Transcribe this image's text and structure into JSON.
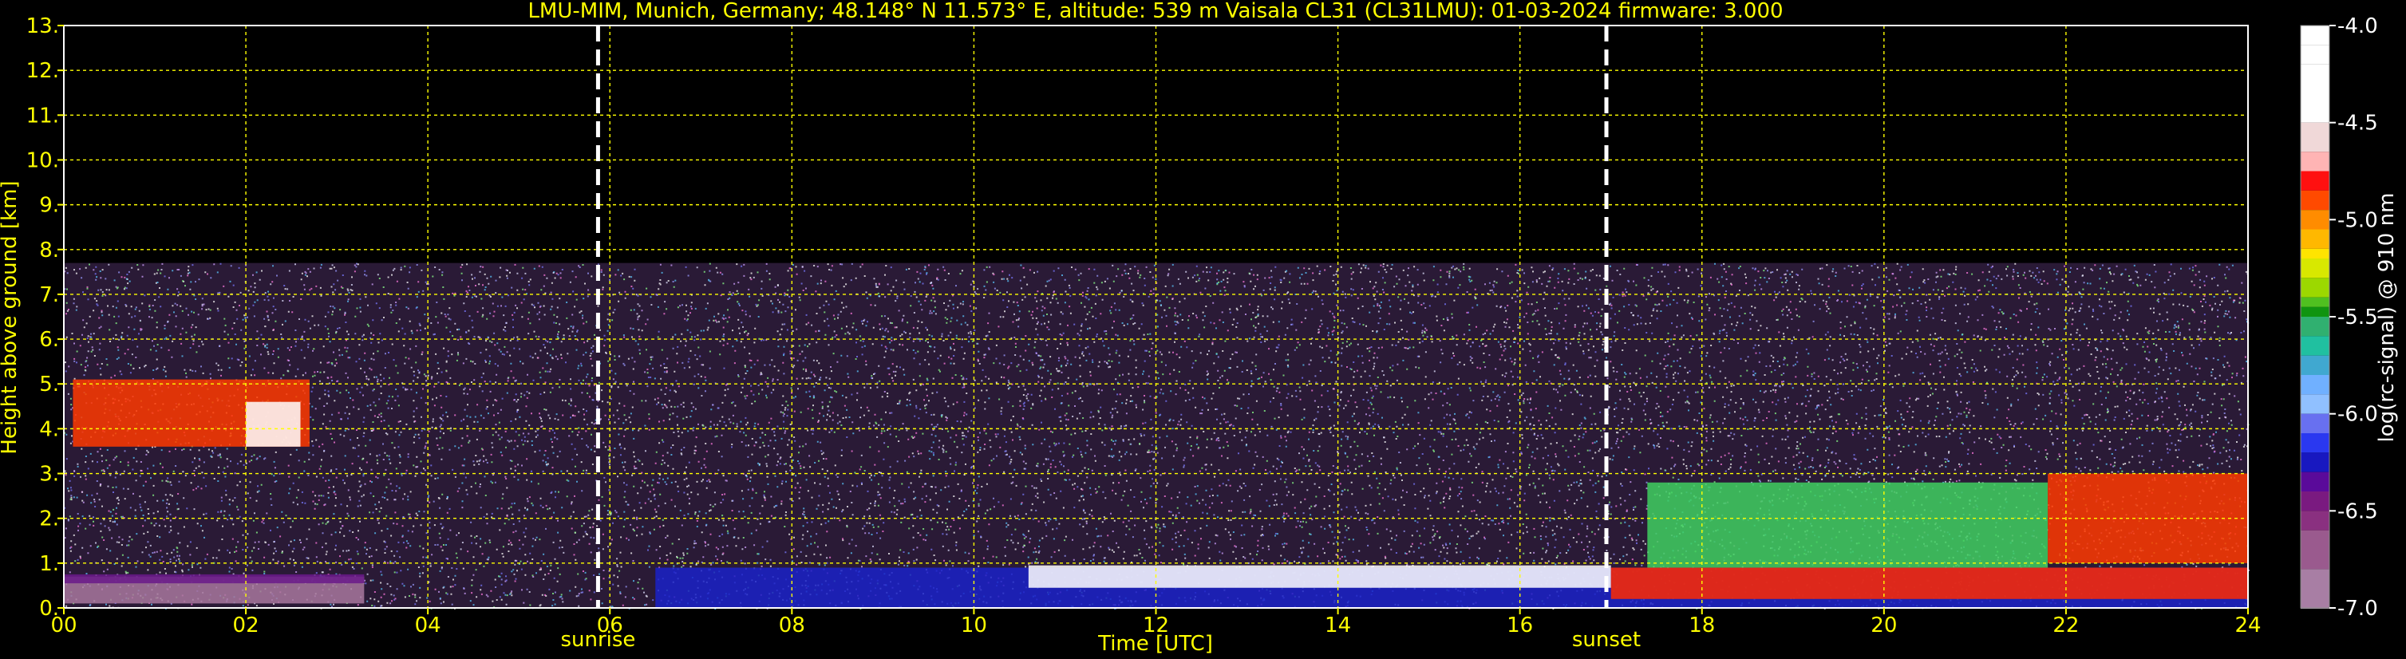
{
  "chart_data": {
    "type": "heatmap",
    "title": "LMU-MIM, Munich, Germany; 48.148° N 11.573° E, altitude: 539 m    Vaisala CL31 (CL31LMU): 01-03-2024    firmware: 3.000",
    "xlabel": "Time [UTC]",
    "ylabel": "Height above ground [km]",
    "xlim": [
      0,
      24
    ],
    "ylim": [
      0,
      13
    ],
    "x_ticks": [
      0,
      2,
      4,
      6,
      8,
      10,
      12,
      14,
      16,
      18,
      20,
      22,
      24
    ],
    "x_tick_labels": [
      "00",
      "02",
      "04",
      "06",
      "08",
      "10",
      "12",
      "14",
      "16",
      "18",
      "20",
      "22",
      "24"
    ],
    "y_ticks": [
      0,
      1,
      2,
      3,
      4,
      5,
      6,
      7,
      8,
      9,
      10,
      11,
      12,
      13
    ],
    "y_tick_labels": [
      "0.",
      "1.",
      "2.",
      "3.",
      "4.",
      "5.",
      "6.",
      "7.",
      "8.",
      "9.",
      "10.",
      "11.",
      "12.",
      "13."
    ],
    "grid": true,
    "grid_color": "#ffff00",
    "vertical_markers": [
      {
        "label": "sunrise",
        "x": 5.87
      },
      {
        "label": "sunset",
        "x": 16.95
      }
    ],
    "colorbar": {
      "label": "log(rc-signal) @ 910 nm",
      "range": [
        -7.0,
        -4.0
      ],
      "ticks": [
        -4.0,
        -4.5,
        -5.0,
        -5.5,
        -6.0,
        -6.5,
        -7.0
      ],
      "tick_labels": [
        "-4.0",
        "-4.5",
        "-5.0",
        "-5.5",
        "-6.0",
        "-6.5",
        "-7.0"
      ],
      "colors": [
        "#ffffff",
        "#ffffff",
        "#ffffff",
        "#ffffff",
        "#f0d8d8",
        "#ffb4b4",
        "#ff1010",
        "#ff4a00",
        "#ff8c00",
        "#ffb800",
        "#ffe400",
        "#d8e800",
        "#9cd800",
        "#50c020",
        "#109410",
        "#30b070",
        "#20c0a0",
        "#40a8d0",
        "#70b0ff",
        "#90c0ff",
        "#6870f0",
        "#2a38f0",
        "#1818c0",
        "#5a0a9a",
        "#7a1a80",
        "#8a3080",
        "#9a5a8e",
        "#a87ea4",
        "#b6a0b4"
      ],
      "color_values": [
        -4.0,
        -4.1,
        -4.2,
        -4.3,
        -4.5,
        -4.65,
        -4.75,
        -4.85,
        -4.95,
        -5.05,
        -5.15,
        -5.2,
        -5.3,
        -5.4,
        -5.45,
        -5.5,
        -5.6,
        -5.7,
        -5.8,
        -5.9,
        -6.0,
        -6.1,
        -6.2,
        -6.3,
        -6.4,
        -6.5,
        -6.6,
        -6.8,
        -7.0
      ]
    },
    "noise_top_km": 7.7,
    "features": [
      {
        "name": "surface layer",
        "t0": 0,
        "t1": 3.3,
        "h0": 0.1,
        "h1": 0.7,
        "color": "#a8789e"
      },
      {
        "name": "residual layer",
        "t0": 0,
        "t1": 3.3,
        "h0": 0.55,
        "h1": 0.75,
        "color": "#6a1a8a"
      },
      {
        "name": "cirrus band",
        "t0": 0.1,
        "t1": 2.7,
        "h0": 3.6,
        "h1": 5.1,
        "color": "#ff3a00"
      },
      {
        "name": "cirrus core",
        "t0": 2.0,
        "t1": 2.6,
        "h0": 3.6,
        "h1": 4.6,
        "color": "#ffffff"
      },
      {
        "name": "boundary layer",
        "t0": 6.5,
        "t1": 24,
        "h0": 0.0,
        "h1": 0.9,
        "color": "#1a22c8"
      },
      {
        "name": "cloud base",
        "t0": 10.6,
        "t1": 17.0,
        "h0": 0.45,
        "h1": 0.95,
        "color": "#ffffff"
      },
      {
        "name": "evening layer",
        "t0": 17.0,
        "t1": 24.0,
        "h0": 0.2,
        "h1": 0.9,
        "color": "#ff2a00"
      },
      {
        "name": "evening cloud",
        "t0": 17.4,
        "t1": 21.8,
        "h0": 0.9,
        "h1": 2.8,
        "color": "#40d060"
      },
      {
        "name": "evening cloud",
        "t0": 21.8,
        "t1": 24.0,
        "h0": 1.0,
        "h1": 3.0,
        "color": "#ff3a00"
      }
    ]
  }
}
